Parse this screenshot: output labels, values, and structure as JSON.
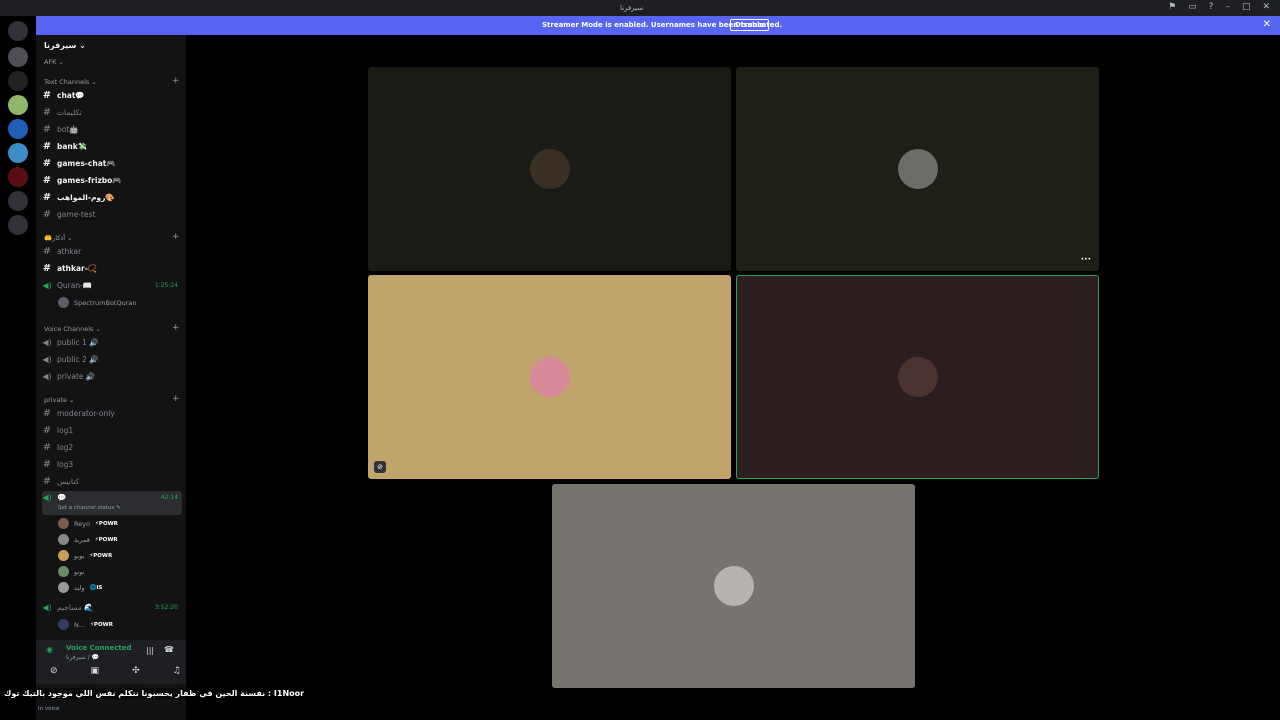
{
  "titlebar": {
    "title": "سيرفرنا",
    "icons": [
      "flag-icon",
      "inbox-icon",
      "help-icon",
      "minimize-icon",
      "maximize-icon",
      "close-icon"
    ]
  },
  "banner": {
    "message": "Streamer Mode is enabled. Usernames have been truncated.",
    "disable_label": "Disable",
    "close": "✕"
  },
  "sidebar": {
    "server_name": "سيرفرنا ⌄",
    "afk": "AFK ⌄",
    "text_category": "Text Channels ⌄",
    "channels": [
      {
        "name": "chat💬",
        "unread": true
      },
      {
        "name": "تكليمات",
        "unread": false
      },
      {
        "name": "bot🤖",
        "unread": false
      },
      {
        "name": "bank💸",
        "unread": true
      },
      {
        "name": "games-chat🎮",
        "unread": true
      },
      {
        "name": "games-frizbo🎮",
        "unread": true
      },
      {
        "name": "روم-المواهب🎨",
        "unread": true
      },
      {
        "name": "game-test",
        "unread": false
      }
    ],
    "azkar_category": "🤲أذكار ⌄",
    "azkar": [
      {
        "name": "athkar",
        "unread": false
      },
      {
        "name": "athkar-📿",
        "unread": true
      }
    ],
    "quran_channel": {
      "name": "Quran-📖",
      "time": "1:25:24",
      "user": "SpectrumBotQuran"
    },
    "voice_category": "Voice Channels ⌄",
    "voice": [
      {
        "name": "public 1 🔊"
      },
      {
        "name": "public 2 🔊"
      },
      {
        "name": "private 🔊"
      }
    ],
    "private_category": "private ⌄",
    "private": [
      {
        "name": "moderator-only"
      },
      {
        "name": "log1"
      },
      {
        "name": "log2"
      },
      {
        "name": "log3"
      },
      {
        "name": "كتابيس"
      }
    ],
    "active_voice": {
      "name": "💬",
      "time": "42:14",
      "status": "Set a channel status ✎"
    },
    "voice_users": [
      {
        "name": "Reyo",
        "tag": "⚡POWR"
      },
      {
        "name": "قمرية",
        "tag": "⚡POWR"
      },
      {
        "name": "بوبو",
        "tag": "⚡POWR"
      },
      {
        "name": "نونو",
        "tag": ""
      },
      {
        "name": "وليد",
        "tag": "🌐IS"
      }
    ],
    "second_voice": {
      "name": "مساجيم 🌊",
      "time": "3:52:20",
      "user": "N...",
      "user_tag": "⚡POWR"
    }
  },
  "voice_connected": {
    "title": "Voice Connected",
    "subtitle": "سيرفرنا / 💬"
  },
  "caption": "نفسنة الحين في ظفار يحسبونا نتكلم نفس اللي موجود بالتيك توك : I1Noor",
  "bottom_status": "In voice",
  "tiles": [
    {
      "bg": "#1b1b15",
      "avatar": "#3a2f25",
      "speaking": false
    },
    {
      "bg": "#1f1f17",
      "avatar": "#6b6e68",
      "speaking": false
    },
    {
      "bg": "#bfa46c",
      "avatar": "#d98a9a",
      "speaking": false
    },
    {
      "bg": "#2c1d1e",
      "avatar": "#4a3330",
      "speaking": true
    },
    {
      "bg": "#77746f",
      "avatar": "#b8b2b0",
      "speaking": false
    }
  ],
  "colors": {
    "accent": "#5865f2",
    "green": "#23a55a"
  }
}
